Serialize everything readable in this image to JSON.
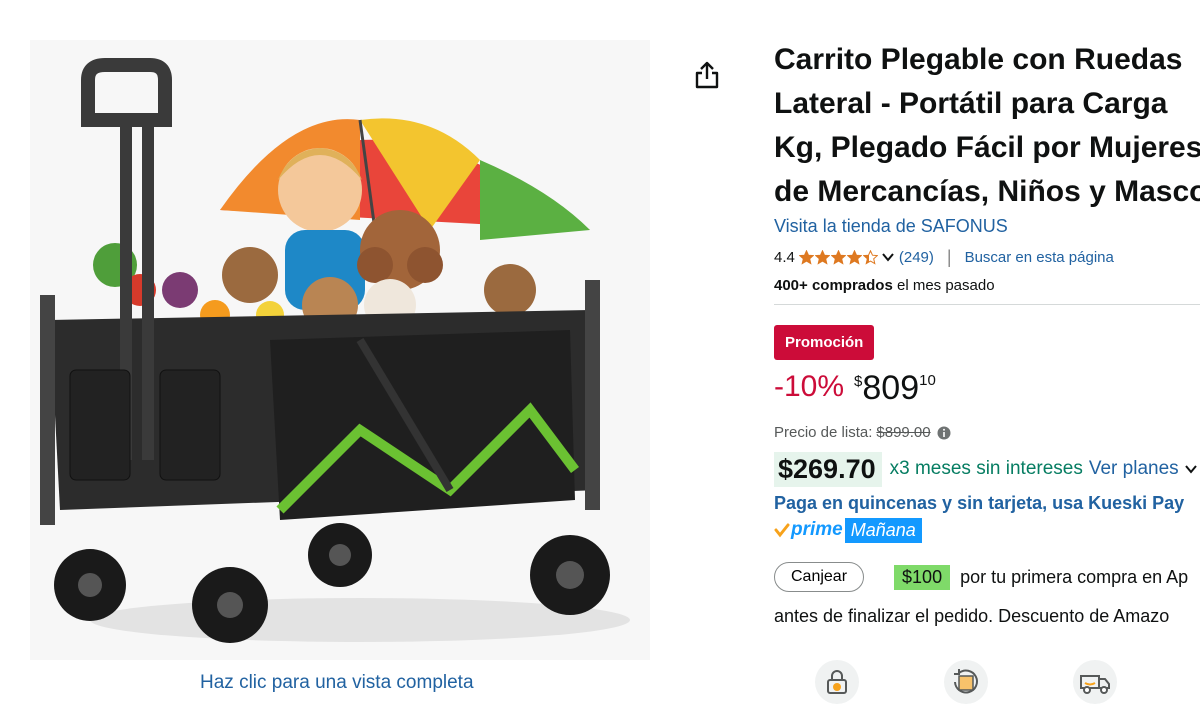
{
  "image": {
    "caption": "Haz clic para una vista completa"
  },
  "product": {
    "title_lines": [
      "Carrito Plegable con Ruedas",
      "Lateral - Portátil para Carga",
      "Kg, Plegado Fácil por Mujeres",
      "de Mercancías, Niños y Masco"
    ],
    "store_link": "Visita la tienda de SAFONUS",
    "rating": "4.4",
    "rating_stars": 4.4,
    "review_count": "(249)",
    "search_page": "Buscar en esta página",
    "bought_bold": "400+ comprados",
    "bought_rest": " el mes pasado"
  },
  "pricing": {
    "promo_label": "Promoción",
    "discount": "-10%",
    "currency_symbol": "$",
    "price_whole": "809",
    "price_fraction": "10",
    "list_price_label": "Precio de lista:",
    "list_price": "$899.00",
    "installment_price": "$269.70",
    "installment_text": "x3 meses sin intereses",
    "installment_link": "Ver planes",
    "kueski_text": "Paga en quincenas y sin tarjeta, usa Kueski Pay",
    "prime_label": "prime",
    "prime_delivery": "Mañana"
  },
  "coupon": {
    "redeem_label": "Canjear",
    "amount": "$100",
    "text": "por tu primera compra en Ap",
    "checkout_text": "antes de finalizar el pedido. Descuento de Amazo"
  },
  "colors": {
    "link": "#2162a1",
    "deal_red": "#cc0c39",
    "prime_blue": "#1399ff",
    "star_orange": "#de7921",
    "installment_green": "#067d62"
  },
  "icons": [
    "share-icon",
    "star-icon",
    "chevron-down-icon",
    "info-icon",
    "prime-check-icon",
    "payment-security-icon",
    "returns-icon",
    "delivery-truck-icon"
  ]
}
